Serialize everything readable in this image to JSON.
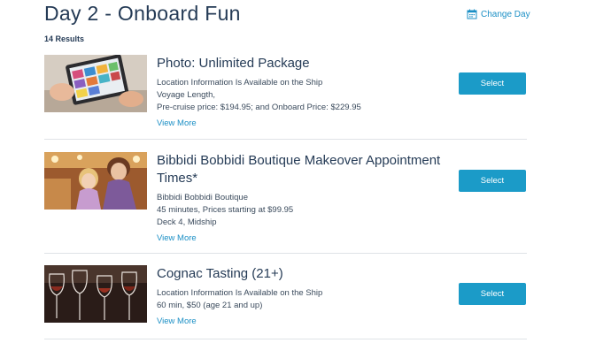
{
  "header": {
    "title": "Day 2 - Onboard Fun",
    "change_day_label": "Change Day",
    "results_count": "14 Results"
  },
  "items": [
    {
      "title": "Photo: Unlimited Package",
      "details": [
        "Location Information Is Available on the Ship",
        "Voyage Length,",
        "Pre-cruise price: $194.95; and Onboard Price: $229.95"
      ],
      "view_more": "View More",
      "select_label": "Select"
    },
    {
      "title": "Bibbidi Bobbidi Boutique Makeover Appointment Times*",
      "details": [
        "Bibbidi Bobbidi Boutique",
        "45 minutes, Prices starting at $99.95",
        "Deck 4, Midship"
      ],
      "view_more": "View More",
      "select_label": "Select"
    },
    {
      "title": "Cognac Tasting (21+)",
      "details": [
        "Location Information Is Available on the Ship",
        "60 min, $50 (age 21 and up)"
      ],
      "view_more": "View More",
      "select_label": "Select"
    }
  ],
  "colors": {
    "accent": "#1b9bc8",
    "link": "#1b8fc5",
    "heading": "#253b56"
  }
}
